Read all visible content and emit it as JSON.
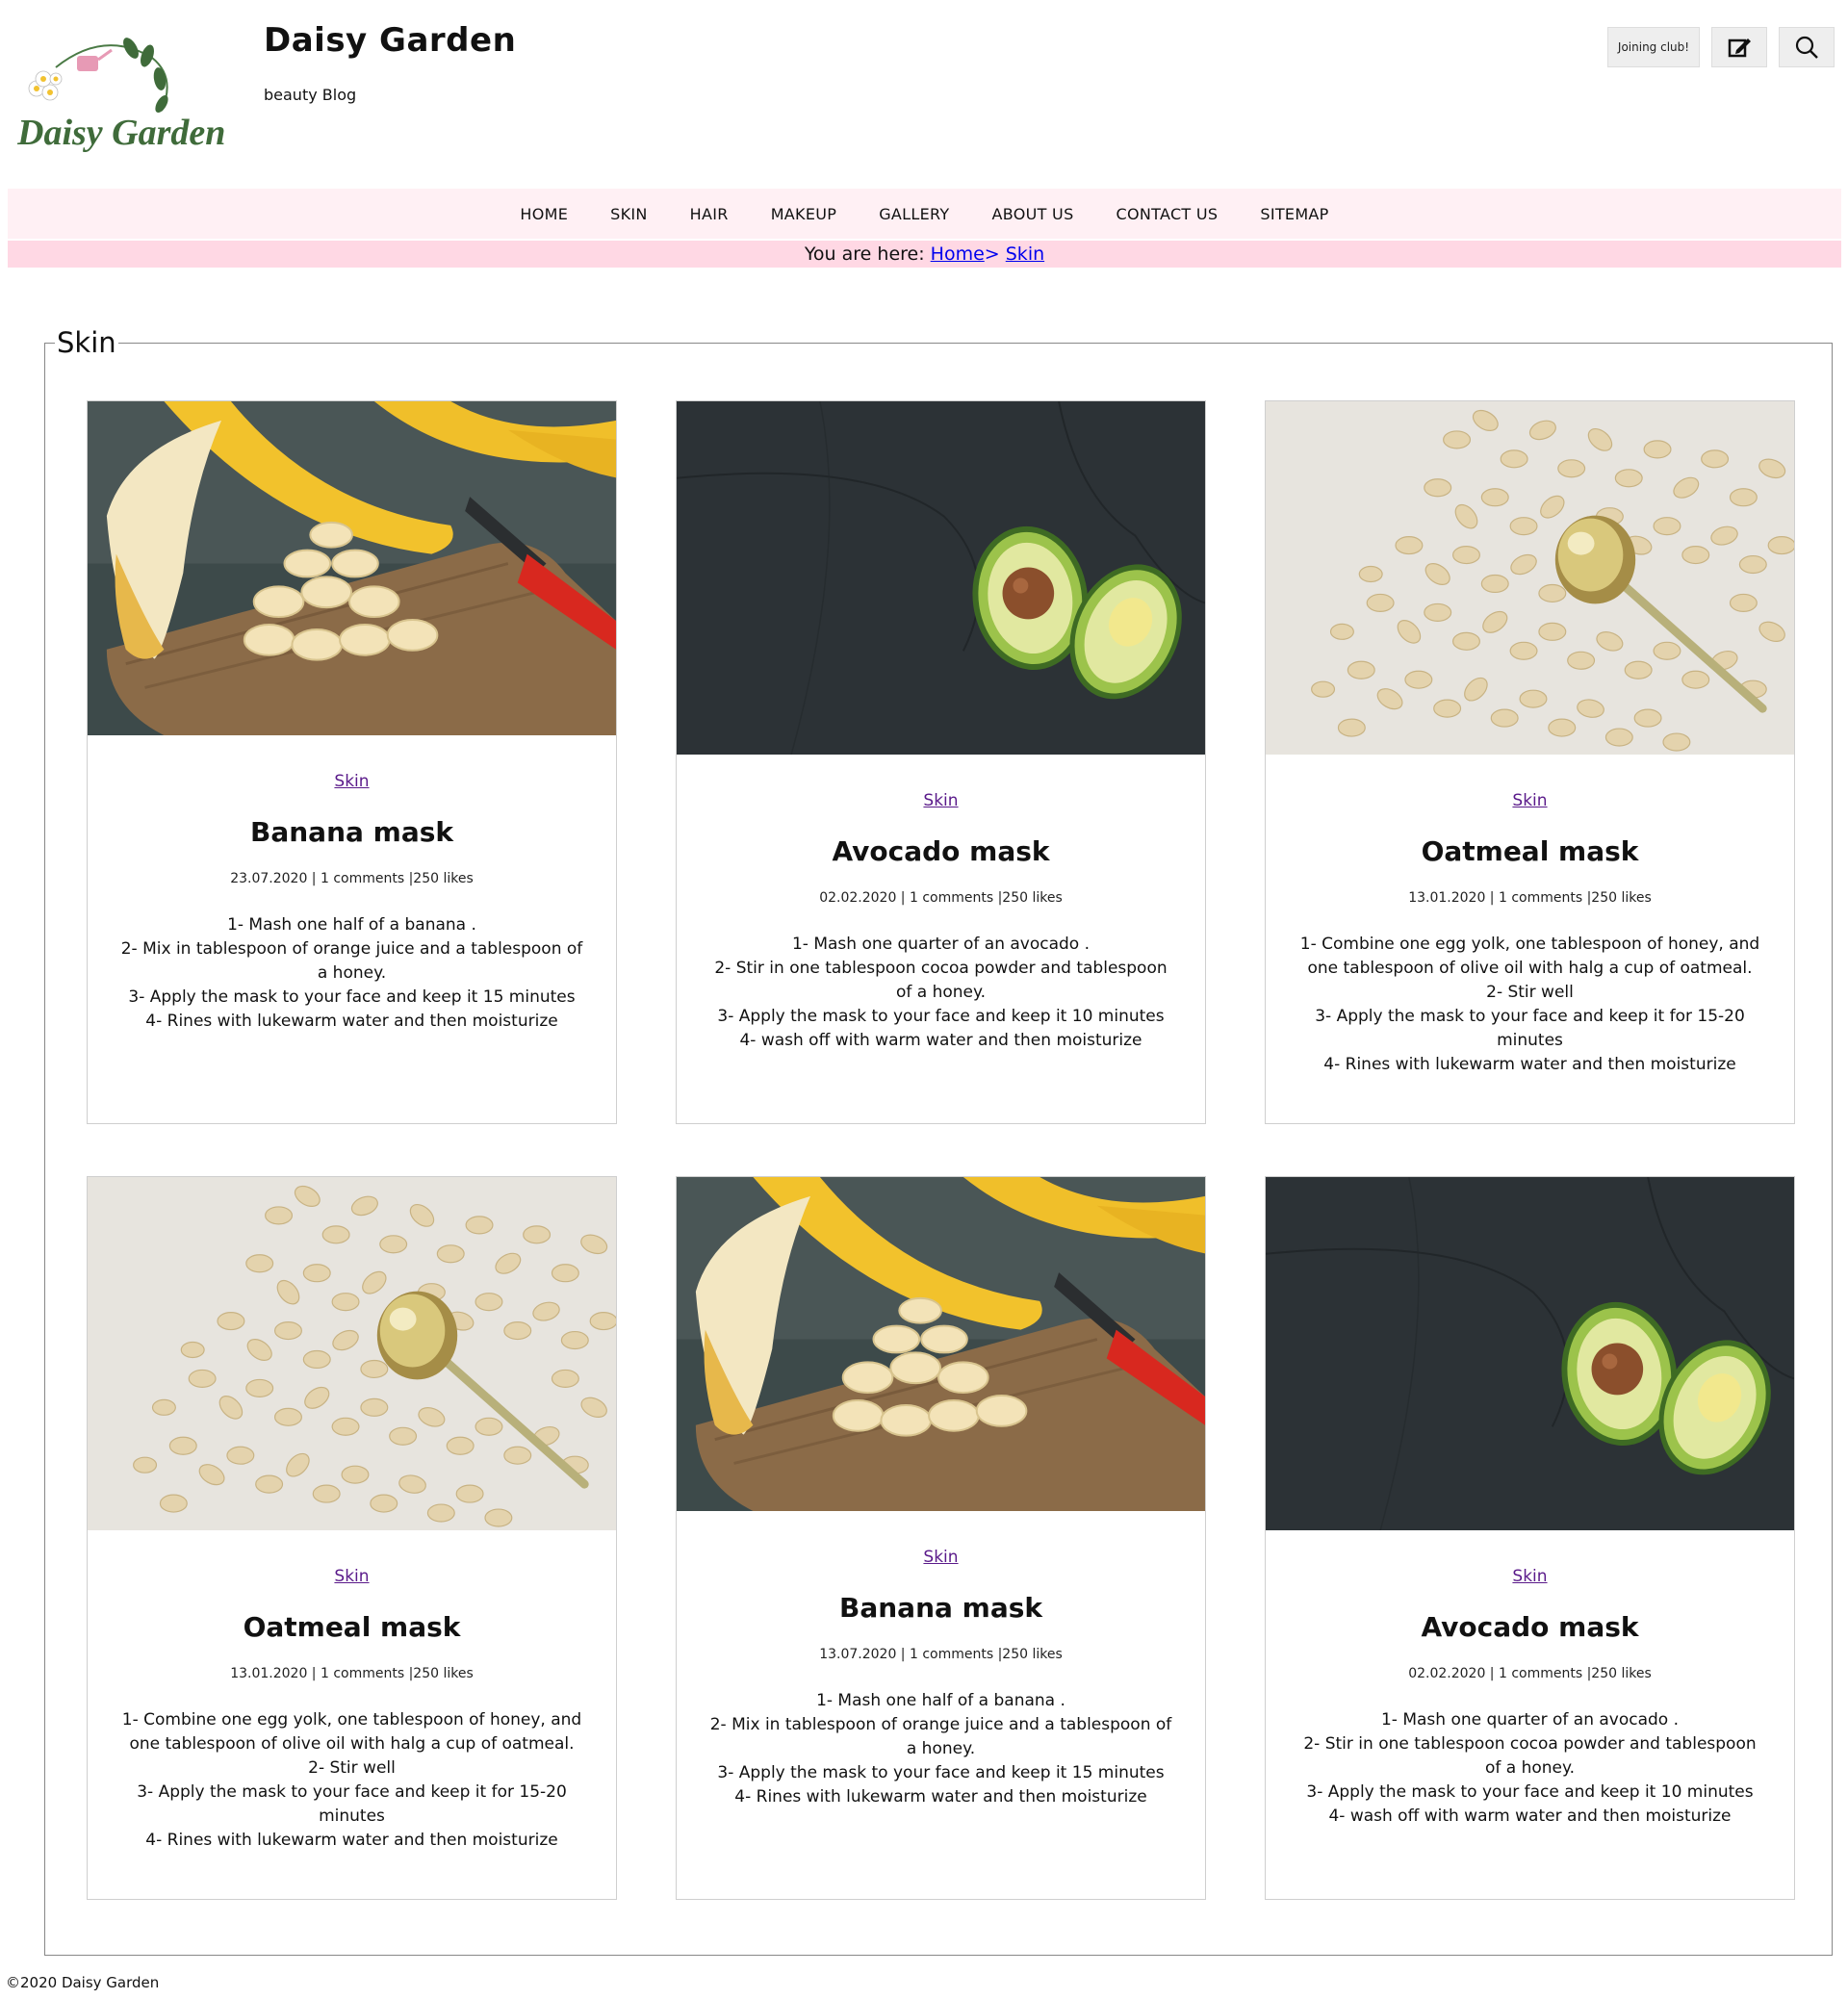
{
  "site": {
    "title": "Daisy Garden",
    "tagline": "beauty Blog",
    "logo_text": "Daisy Garden"
  },
  "header_actions": {
    "join_label": "Joining club!",
    "edit_icon": "edit-icon",
    "search_icon": "search-icon"
  },
  "nav": {
    "items": [
      "HOME",
      "SKIN",
      "HAIR",
      "MAKEUP",
      "GALLERY",
      "ABOUT US",
      "CONTACT US",
      "SITEMAP"
    ]
  },
  "breadcrumb": {
    "prefix": "You are here:",
    "home": "Home",
    "separator": ">",
    "current": "Skin"
  },
  "section": {
    "title": "Skin"
  },
  "cards": [
    {
      "image": "banana-photo",
      "category": "Skin",
      "title": "Banana mask",
      "meta": "23.07.2020 | 1 comments |250 likes",
      "steps": [
        "1- Mash one half of a banana .",
        "2- Mix in tablespoon of orange juice and a tablespoon of a honey.",
        "3- Apply the mask to your face and keep it 15 minutes",
        "4- Rines with lukewarm water and then moisturize"
      ]
    },
    {
      "image": "avocado-photo",
      "category": "Skin",
      "title": "Avocado mask",
      "meta": "02.02.2020 | 1 comments |250 likes",
      "steps": [
        "1- Mash one quarter of an avocado .",
        "2- Stir in one tablespoon cocoa powder and tablespoon of a honey.",
        "3- Apply the mask to your face and keep it 10 minutes",
        "4- wash off with warm water and then moisturize"
      ]
    },
    {
      "image": "oatmeal-photo",
      "category": "Skin",
      "title": "Oatmeal mask",
      "meta": "13.01.2020 | 1 comments |250 likes",
      "steps": [
        "1- Combine one egg yolk, one tablespoon of honey, and one tablespoon of olive oil with halg a cup of oatmeal.",
        "2- Stir well",
        "3- Apply the mask to your face and keep it for 15-20 minutes",
        "4- Rines with lukewarm water and then moisturize"
      ]
    },
    {
      "image": "oatmeal-photo",
      "category": "Skin",
      "title": "Oatmeal mask",
      "meta": "13.01.2020 | 1 comments |250 likes",
      "steps": [
        "1- Combine one egg yolk, one tablespoon of honey, and one tablespoon of olive oil with halg a cup of oatmeal.",
        "2- Stir well",
        "3- Apply the mask to your face and keep it for 15-20 minutes",
        "4- Rines with lukewarm water and then moisturize"
      ]
    },
    {
      "image": "banana-photo",
      "category": "Skin",
      "title": "Banana mask",
      "meta": "13.07.2020 | 1 comments |250 likes",
      "steps": [
        "1- Mash one half of a banana .",
        "2- Mix in tablespoon of orange juice and a tablespoon of a honey.",
        "3- Apply the mask to your face and keep it 15 minutes",
        "4- Rines with lukewarm water and then moisturize"
      ]
    },
    {
      "image": "avocado-photo",
      "category": "Skin",
      "title": "Avocado mask",
      "meta": "02.02.2020 | 1 comments |250 likes",
      "steps": [
        "1- Mash one quarter of an avocado .",
        "2- Stir in one tablespoon cocoa powder and tablespoon of a honey.",
        "3- Apply the mask to your face and keep it 10 minutes",
        "4- wash off with warm water and then moisturize"
      ]
    }
  ],
  "footer": {
    "copyright": "©2020 Daisy Garden"
  },
  "colors": {
    "nav_bg": "#fff0f4",
    "breadcrumb_bg": "#ffd8e4",
    "link": "#0000ee",
    "category_link": "#5a1a8a"
  }
}
